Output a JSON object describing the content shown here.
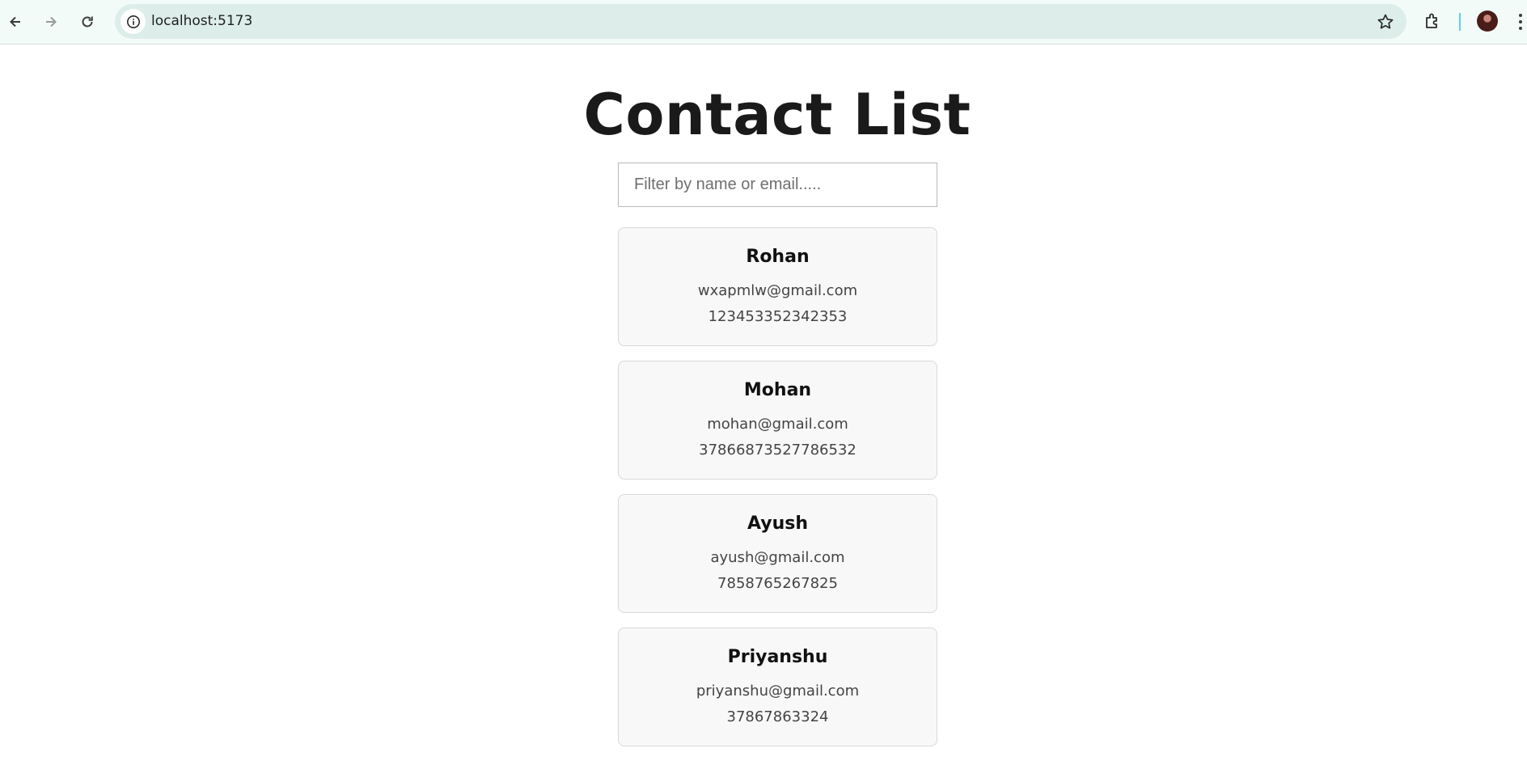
{
  "browser": {
    "url": "localhost:5173",
    "icons": [
      "back-icon",
      "forward-icon",
      "reload-icon",
      "site-info-icon",
      "bookmark-star-icon",
      "extensions-icon",
      "profile-avatar",
      "menu-icon"
    ]
  },
  "page": {
    "title": "Contact List",
    "filter": {
      "placeholder": "Filter by name or email.....",
      "value": ""
    },
    "contacts": [
      {
        "name": "Rohan",
        "email": "wxapmlw@gmail.com",
        "phone": "123453352342353"
      },
      {
        "name": "Mohan",
        "email": "mohan@gmail.com",
        "phone": "37866873527786532"
      },
      {
        "name": "Ayush",
        "email": "ayush@gmail.com",
        "phone": "7858765267825"
      },
      {
        "name": "Priyanshu",
        "email": "priyanshu@gmail.com",
        "phone": "37867863324"
      }
    ]
  },
  "colors": {
    "toolbar_bg": "#f3fbf8",
    "omnibox_bg": "#dcedea",
    "card_bg": "#f8f8f8",
    "card_border": "#d9d9d9",
    "divider_accent": "#5ad3e8"
  }
}
